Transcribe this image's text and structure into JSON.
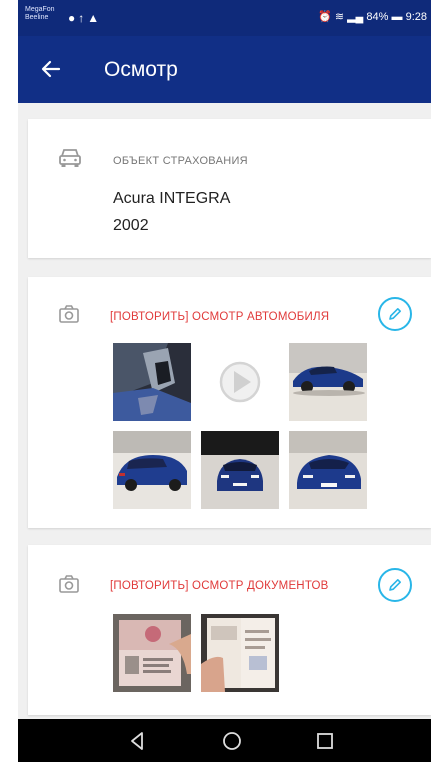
{
  "status_bar": {
    "carrier_line1": "MegaFon",
    "carrier_line2": "Beeline",
    "battery": "84%",
    "time": "9:28"
  },
  "app_bar": {
    "title": "Осмотр"
  },
  "insured_object": {
    "label": "ОБЪЕКТ СТРАХОВАНИЯ",
    "name": "Acura INTEGRA",
    "year": "2002"
  },
  "car_inspection": {
    "title": "[ПОВТОРИТЬ] ОСМОТР АВТОМОБИЛЯ",
    "photos": [
      "car-interior-photo",
      "video-placeholder",
      "car-side-photo",
      "car-rear-photo",
      "car-front-photo",
      "car-front-angle-photo"
    ]
  },
  "documents_inspection": {
    "title": "[ПОВТОРИТЬ] ОСМОТР ДОКУМЕНТОВ",
    "photos": [
      "passport-photo-page",
      "passport-stamp-page"
    ]
  },
  "colors": {
    "primary": "#112f86",
    "accent_red": "#e03a3a",
    "edit_blue": "#29b6e8"
  }
}
